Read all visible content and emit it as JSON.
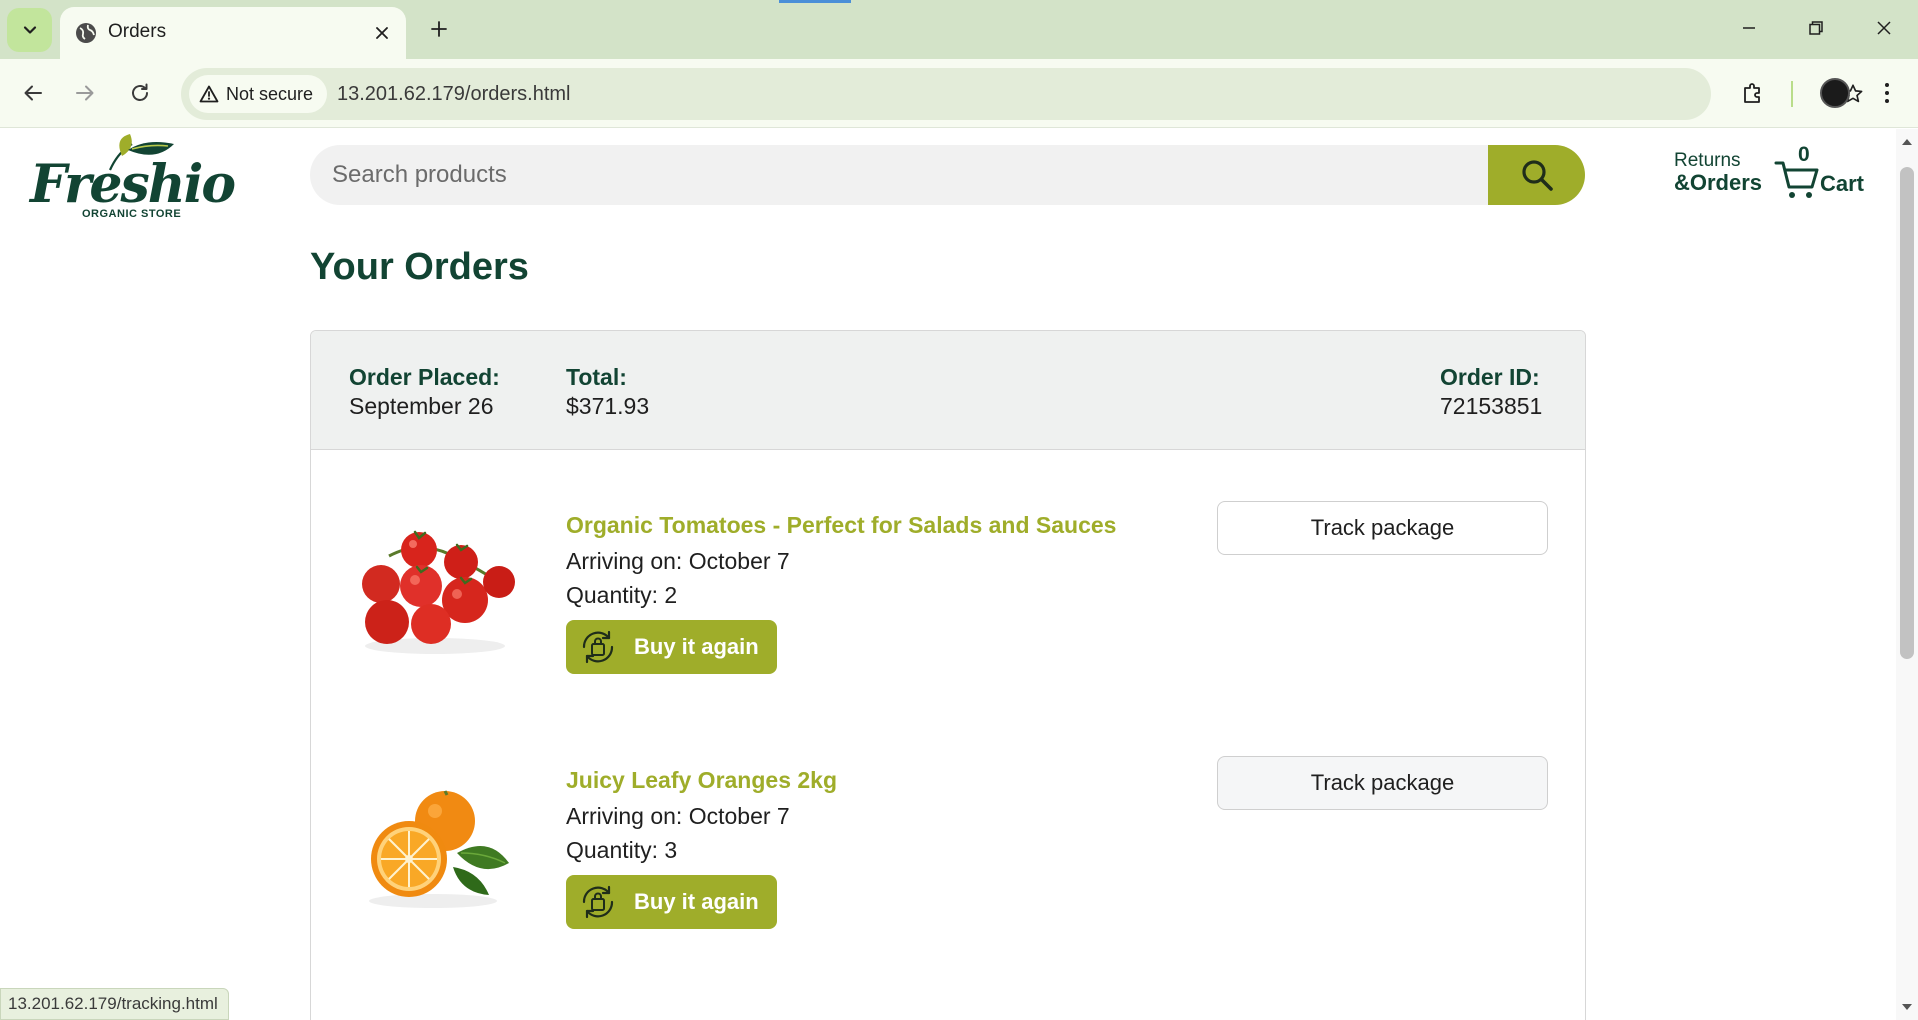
{
  "browser": {
    "tab_title": "Orders",
    "security_label": "Not secure",
    "url": "13.201.62.179/orders.html",
    "status_url": "13.201.62.179/tracking.html",
    "accent_color": "#c2e59c"
  },
  "site": {
    "logo_text": "Freshio",
    "logo_subtitle": "ORGANIC STORE",
    "search_placeholder": "Search products",
    "returns_top": "Returns",
    "returns_bottom": "&Orders",
    "cart_count": "0",
    "cart_label": "Cart",
    "brand_color": "#124433",
    "accent_color": "#9fad2a"
  },
  "page": {
    "title": "Your Orders"
  },
  "order": {
    "placed_label": "Order Placed:",
    "placed_value": "September 26",
    "total_label": "Total:",
    "total_value": "$371.93",
    "id_label": "Order ID:",
    "id_value": "72153851",
    "items": [
      {
        "name": "Organic Tomatoes - Perfect for Salads and Sauces",
        "arrival": "Arriving on: October 7",
        "quantity": "Quantity: 2",
        "buy_again_label": "Buy it again",
        "track_label": "Track package",
        "image": "tomatoes-image"
      },
      {
        "name": "Juicy Leafy Oranges 2kg",
        "arrival": "Arriving on: October 7",
        "quantity": "Quantity: 3",
        "buy_again_label": "Buy it again",
        "track_label": "Track package",
        "image": "oranges-image"
      }
    ]
  }
}
